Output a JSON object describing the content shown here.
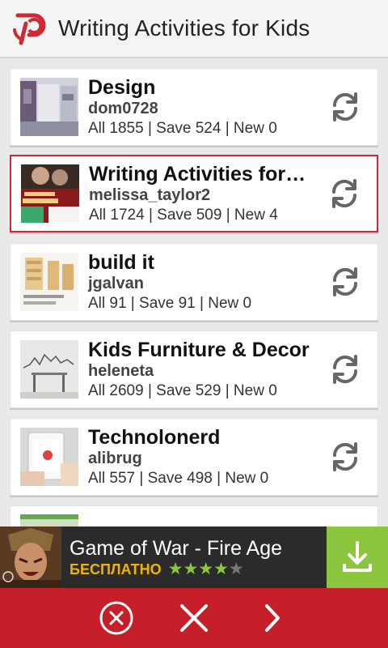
{
  "header": {
    "title": "Writing Activities for Kids",
    "logo_icon": "pin-logo-icon",
    "brand_color": "#cc2a35"
  },
  "boards": [
    {
      "name": "Design",
      "owner": "dom0728",
      "stats": "All 1855 | Save 524 | New 0",
      "selected": false,
      "thumb": "design-thumbnail"
    },
    {
      "name": "Writing Activities for…",
      "owner": "melissa_taylor2",
      "stats": "All 1724 | Save 509 | New 4",
      "selected": true,
      "thumb": "writing-thumbnail"
    },
    {
      "name": "build it",
      "owner": "jgalvan",
      "stats": "All 91 | Save 91 | New 0",
      "selected": false,
      "thumb": "build-thumbnail"
    },
    {
      "name": "Kids Furniture & Decor",
      "owner": "heleneta",
      "stats": "All 2609 | Save 529 | New 0",
      "selected": false,
      "thumb": "furniture-thumbnail"
    },
    {
      "name": "Technolonerd",
      "owner": "alibrug",
      "stats": "All 557 | Save 498 | New 0",
      "selected": false,
      "thumb": "tech-thumbnail"
    }
  ],
  "ad": {
    "title": "Game of War - Fire Age",
    "free_label": "БЕСПЛАТНО",
    "rating": 4,
    "rating_max": 5,
    "download_icon": "download-icon",
    "colors": {
      "download": "#8cc63f",
      "free": "#f0b400"
    }
  },
  "bottom_bar": {
    "icons": [
      "cancel-circle-icon",
      "close-icon",
      "chevron-right-icon"
    ],
    "color": "#c61f2a"
  }
}
